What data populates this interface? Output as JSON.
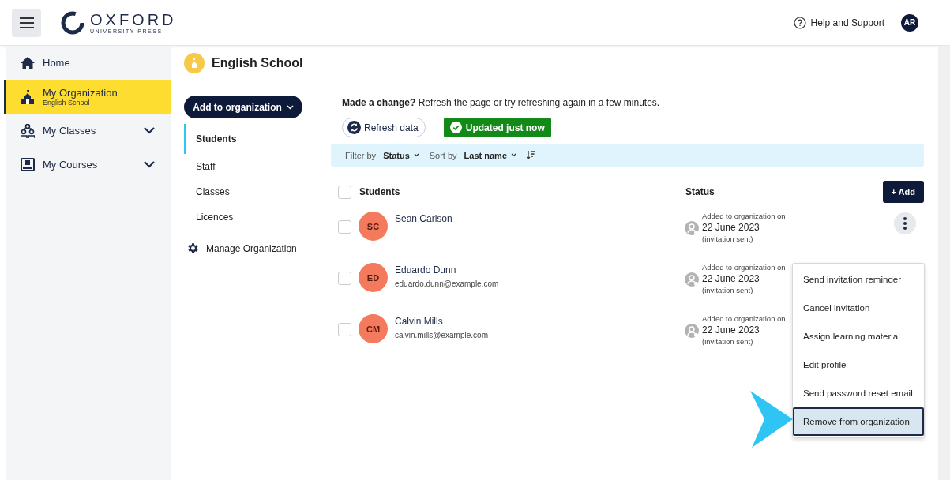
{
  "header": {
    "logo_name": "OXFORD",
    "logo_sub": "UNIVERSITY PRESS",
    "help": "Help and Support",
    "avatar": "AR"
  },
  "sidebar": {
    "items": [
      {
        "label": "Home",
        "selected": false,
        "expandable": false
      },
      {
        "label": "My Organization",
        "sublabel": "English School",
        "selected": true,
        "expandable": false
      },
      {
        "label": "My Classes",
        "selected": false,
        "expandable": true
      },
      {
        "label": "My Courses",
        "selected": false,
        "expandable": true
      }
    ]
  },
  "organization": {
    "name": "English School"
  },
  "add_menu_button": "Add to organization",
  "subnav": {
    "items": [
      {
        "label": "Students",
        "selected": true
      },
      {
        "label": "Staff",
        "selected": false
      },
      {
        "label": "Classes",
        "selected": false
      },
      {
        "label": "Licences",
        "selected": false
      }
    ],
    "manage": "Manage Organization"
  },
  "notice": "**Made a change?** Refresh the page or try refreshing again in a few minutes.",
  "refresh_button": "Refresh data",
  "updated_badge": "Updated just now",
  "filters": {
    "filter_label": "Filter by",
    "filter_value": "Status",
    "sort_label": "Sort by",
    "sort_value": "Last name"
  },
  "table": {
    "select_all_checked": false,
    "columns": [
      "Students",
      "Status"
    ],
    "add_button": "+ Add",
    "rows": [
      {
        "initials": "SC",
        "name": "Sean Carlson",
        "checked": false,
        "status_caption": "Added to organization on",
        "date": "22 June 2023",
        "note": "(invitation sent)"
      },
      {
        "initials": "ED",
        "name": "Eduardo Dunn",
        "email": "eduardo.dunn@example.com",
        "checked": false,
        "status_caption": "Added to organization on",
        "date": "22 June 2023",
        "note": "(invitation sent)"
      },
      {
        "initials": "CM",
        "name": "Calvin Mills",
        "email": "calvin.mills@example.com",
        "checked": false,
        "status_caption": "Added to organization on",
        "date": "22 June 2023",
        "note": "(invitation sent)"
      }
    ]
  },
  "context_menu": {
    "items": [
      {
        "label": "Send invitation reminder",
        "selected": false
      },
      {
        "label": "Cancel invitation",
        "selected": false
      },
      {
        "label": "Assign learning material",
        "selected": false
      },
      {
        "label": "Edit profile",
        "selected": false
      },
      {
        "label": "Send password reset email",
        "selected": false
      },
      {
        "label": "Remove from organization",
        "selected": true
      }
    ]
  }
}
